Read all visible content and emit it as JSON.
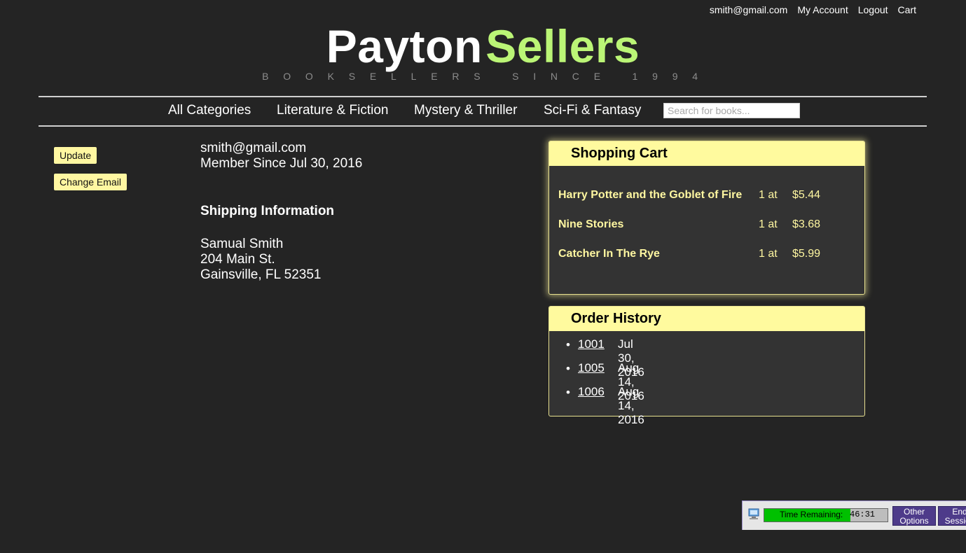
{
  "header": {
    "links": [
      "smith@gmail.com",
      "My Account",
      "Logout",
      "Cart"
    ],
    "brand_main": "Payton",
    "brand_accent": "Sellers",
    "tagline": "BOOKSELLERS SINCE 1994"
  },
  "nav": {
    "items": [
      "All Categories",
      "Literature & Fiction",
      "Mystery & Thriller",
      "Sci-Fi & Fantasy"
    ],
    "search_placeholder": "Search for books..."
  },
  "account": {
    "update_label": "Update",
    "change_email_label": "Change Email",
    "email": "smith@gmail.com",
    "member_since": "Member Since Jul 30, 2016",
    "shipping_heading": "Shipping Information",
    "address": [
      "Samual Smith",
      "204 Main St.",
      "Gainsville, FL 52351"
    ]
  },
  "cart": {
    "title": "Shopping Cart",
    "items": [
      {
        "title": "Harry Potter and the Goblet of Fire",
        "qty": "1 at",
        "price": "$5.44"
      },
      {
        "title": "Nine Stories",
        "qty": "1 at",
        "price": "$3.68"
      },
      {
        "title": "Catcher In The Rye",
        "qty": "1 at",
        "price": "$5.99"
      }
    ]
  },
  "orders": {
    "title": "Order History",
    "items": [
      {
        "id": "1001",
        "date": "Jul 30, 2016"
      },
      {
        "id": "1005",
        "date": "Aug 14, 2016"
      },
      {
        "id": "1006",
        "date": "Aug 14, 2016"
      }
    ]
  },
  "session": {
    "label": "Time Remaining:",
    "time": "46:31",
    "remaining_fraction": 0.7,
    "other_options": [
      "Other",
      "Options"
    ],
    "end_session": [
      "End",
      "Session"
    ]
  },
  "colors": {
    "background": "#242424",
    "accent": "#bbf576",
    "panel_header": "#fffa9e",
    "cart_text": "#fff7a1"
  }
}
